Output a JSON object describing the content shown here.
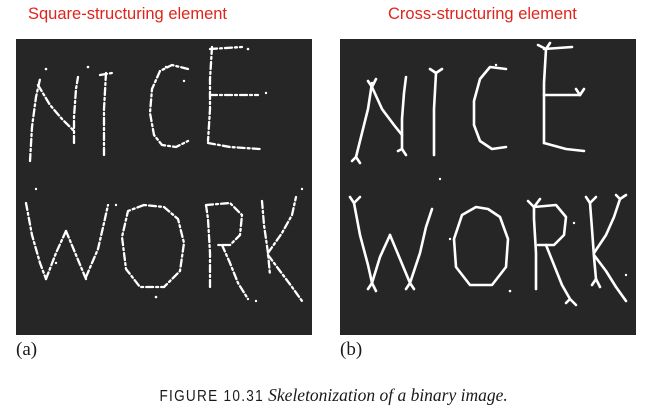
{
  "panels": [
    {
      "heading": "Square-structuring element",
      "label": "(a)"
    },
    {
      "heading": "Cross-structuring element",
      "label": "(b)"
    }
  ],
  "caption": {
    "figure_number": "FIGURE 10.31",
    "text": "Skeletonization of a binary image."
  },
  "colors": {
    "heading": "#e0241b",
    "image_background": "#262626",
    "skeleton": "#ffffff"
  }
}
